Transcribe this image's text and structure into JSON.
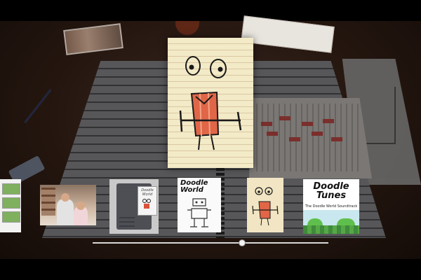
{
  "featured_doodle": {
    "description_icon": "doodle-creature-icon"
  },
  "carousel": {
    "items": [
      {
        "id": "screens-partial",
        "icon": "screenshot-strip-icon"
      },
      {
        "id": "family-photo",
        "icon": "photo-icon"
      },
      {
        "id": "cartridge",
        "label": "Doodle World",
        "icon": "game-cartridge-icon"
      },
      {
        "id": "doodle-world-art",
        "label": "Doodle\nWorld",
        "icon": "doodle-art-icon"
      },
      {
        "id": "creature-doodle",
        "icon": "doodle-creature-icon"
      },
      {
        "id": "doodle-tunes",
        "title": "Doodle\nTunes",
        "subtitle": "The Doodle World Soundtrack",
        "icon": "album-cover-icon"
      }
    ],
    "selected_index": 4
  },
  "slider": {
    "position_fraction": 0.635
  },
  "colors": {
    "desk": "#24160f",
    "paper": "#f3eac7",
    "ink": "#1a1a1a",
    "red": "#d9533a",
    "slider": "#d8d8d8"
  }
}
